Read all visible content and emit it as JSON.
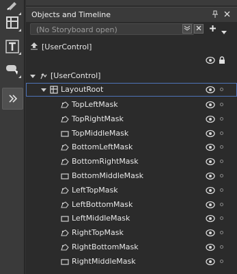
{
  "panel": {
    "title": "Objects and Timeline",
    "pin_icon": "pin-icon",
    "close_icon": "close-icon"
  },
  "storyboard": {
    "placeholder": "(No Storyboard open)",
    "icons": [
      "storyboard-dropdown-icon",
      "close-storyboard-icon",
      "add-storyboard-icon",
      "options-chevron-icon"
    ]
  },
  "scope": {
    "label": "[UserControl]"
  },
  "tree": {
    "root": {
      "label": "[UserControl]"
    },
    "layout_root": {
      "label": "LayoutRoot"
    },
    "children": [
      {
        "label": "TopLeftMask",
        "icon": "path-icon"
      },
      {
        "label": "TopRightMask",
        "icon": "path-icon"
      },
      {
        "label": "TopMiddleMask",
        "icon": "rectangle-icon"
      },
      {
        "label": "BottomLeftMask",
        "icon": "path-icon"
      },
      {
        "label": "BottomRightMask",
        "icon": "path-icon"
      },
      {
        "label": "BottomMiddleMask",
        "icon": "rectangle-icon"
      },
      {
        "label": "LeftTopMask",
        "icon": "path-icon"
      },
      {
        "label": "LeftBottomMask",
        "icon": "path-icon"
      },
      {
        "label": "LeftMiddleMask",
        "icon": "rectangle-icon"
      },
      {
        "label": "RightTopMask",
        "icon": "path-icon"
      },
      {
        "label": "RightBottomMask",
        "icon": "path-icon"
      },
      {
        "label": "RightMiddleMask",
        "icon": "rectangle-icon"
      }
    ]
  },
  "toolbox": [
    "brush-tool-icon",
    "grid-tool-icon",
    "text-tool-icon",
    "comment-tool-icon",
    "expand-toolbox-icon"
  ],
  "colors": {
    "selection": "#4f74b9",
    "panel_bg": "#2b2b2b",
    "header_bg": "#3a3a3a"
  }
}
